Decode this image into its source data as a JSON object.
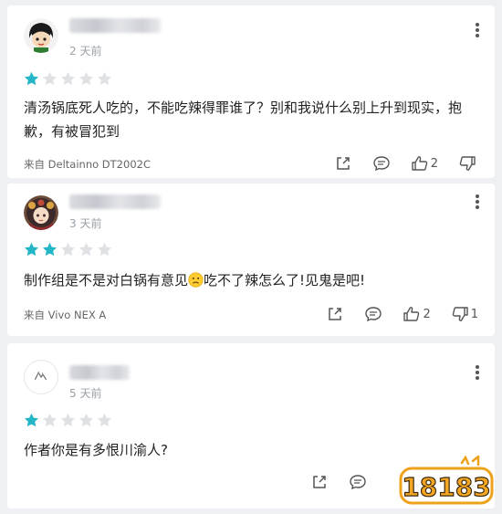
{
  "comments": [
    {
      "time": "2 天前",
      "rating": 1,
      "text": "清汤锅底死人吃的，不能吃辣得罪谁了？别和我说什么别上升到现实，抱歉，有被冒犯到",
      "device": "来自 Deltainno DT2002C",
      "likes": "2",
      "dislikes": ""
    },
    {
      "time": "3 天前",
      "rating": 2,
      "text_before": "制作组是不是对白锅有意见",
      "text_after": "吃不了辣怎么了!见鬼是吧!",
      "device": "来自 Vivo NEX A",
      "likes": "2",
      "dislikes": "1"
    },
    {
      "time": "5 天前",
      "rating": 1,
      "text": "作者你是有多恨川渝人?"
    }
  ],
  "watermark": {
    "text": "18183"
  },
  "colors": {
    "star_active": "#23b6c6",
    "star_inactive": "#dfe1e5",
    "background": "#eef0f3"
  },
  "icons": [
    "more-icon",
    "star-icon",
    "share-icon",
    "reply-icon",
    "like-icon",
    "dislike-icon",
    "sad-face-icon"
  ]
}
